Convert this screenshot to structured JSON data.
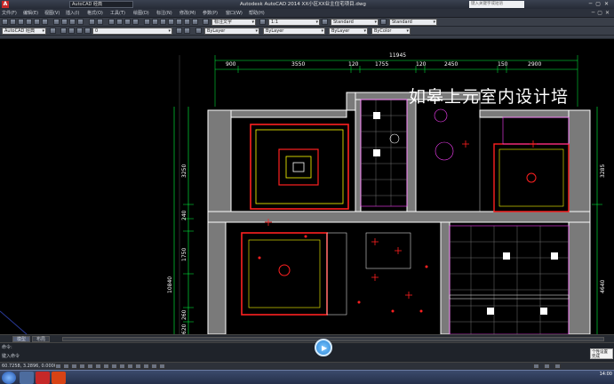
{
  "window": {
    "workspace": "AutoCAD 经典",
    "title": "Autodesk AutoCAD 2014    XX小区XX业主住宅项目.dwg",
    "search_placeholder": "键入关键字或短语"
  },
  "menu": [
    "文件(F)",
    "编辑(E)",
    "视图(V)",
    "插入(I)",
    "格式(O)",
    "工具(T)",
    "绘图(D)",
    "标注(N)",
    "修改(M)",
    "参数(P)",
    "窗口(W)",
    "帮助(H)"
  ],
  "toolbar": {
    "workspace_select": "AutoCAD 经典",
    "layer_select": "0",
    "color_select": "ByLayer",
    "linetype_select": "ByLayer",
    "lineweight_select": "ByLayer",
    "plotstyle_select": "ByColor",
    "text_style": "Standard",
    "dim_style": "1:1",
    "table_style": "Standard",
    "mleader_style": "Standard",
    "annotative": "标注文字"
  },
  "drawing": {
    "top_dim_total": "11945",
    "top_dims": [
      "900",
      "3550",
      "120",
      "1755",
      "120",
      "2450",
      "150",
      "2900"
    ],
    "left_dims": [
      "3250",
      "240",
      "1750",
      "10840",
      "260",
      "620"
    ],
    "right_dims": [
      "3285",
      "4640"
    ],
    "watermark": "如皋上元室内设计培",
    "colors": {
      "wall": "#ffffff",
      "yellow": "#ffff00",
      "red": "#ff2020",
      "magenta": "#ff40ff",
      "green": "#00ff40",
      "cyan": "#00e0ff",
      "grey": "#8a8a8a"
    }
  },
  "tabs": [
    "模型",
    "布局"
  ],
  "command": {
    "history": "命令:",
    "prompt": "键入命令"
  },
  "status": {
    "coords": "60.7258, 3.2896, 0.0000"
  },
  "notification": "个性设置 完成",
  "clock": "14:00"
}
